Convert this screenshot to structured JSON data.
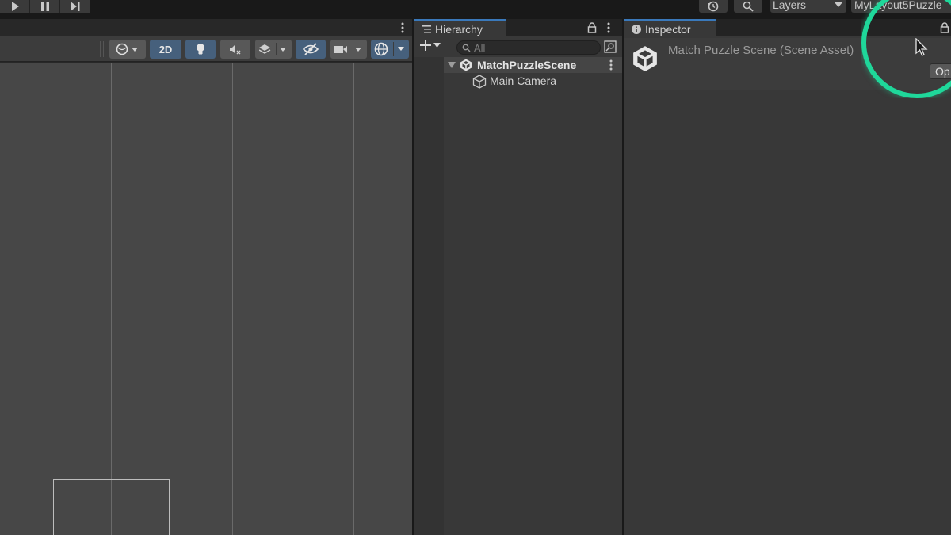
{
  "toolbar": {
    "layers_label": "Layers",
    "layout_label": "MyLayout5Puzzle"
  },
  "scene_view": {
    "toolbar": {
      "mode_2d_label": "2D"
    }
  },
  "hierarchy": {
    "tab_label": "Hierarchy",
    "search_placeholder": "All",
    "scene_name": "MatchPuzzleScene",
    "objects": [
      {
        "name": "Main Camera"
      }
    ]
  },
  "inspector": {
    "tab_label": "Inspector",
    "title": "Match Puzzle Scene (Scene Asset)",
    "open_button_label": "Op"
  },
  "colors": {
    "accent_tab": "#3a79bb",
    "click_ring": "#1fd79a",
    "toggle_active": "#46607c"
  },
  "icons": [
    "play-icon",
    "pause-icon",
    "step-icon",
    "history-icon",
    "search-icon",
    "kebab-icon",
    "lock-icon",
    "plus-icon",
    "unity-scene-icon",
    "cube-icon",
    "info-icon",
    "cursor-icon"
  ]
}
